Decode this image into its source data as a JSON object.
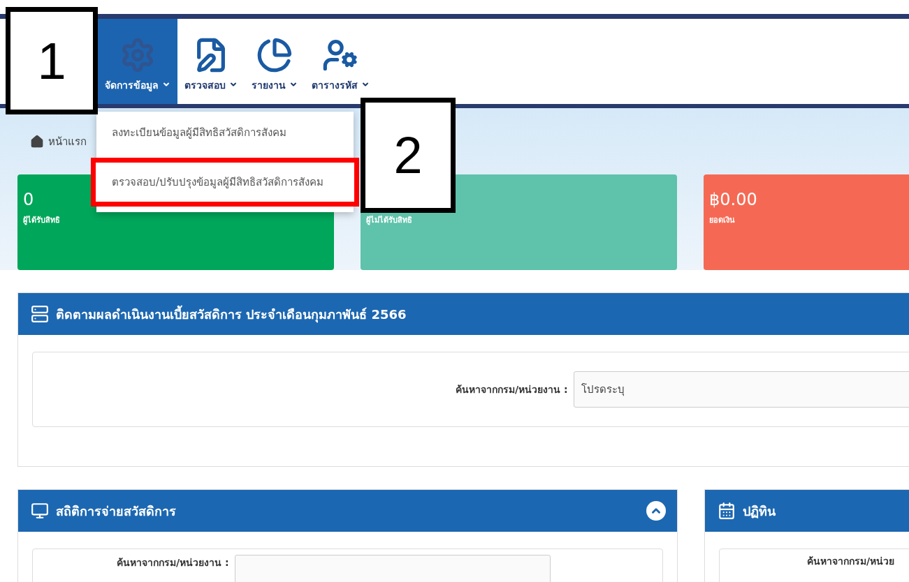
{
  "nav": {
    "items": [
      {
        "label": "จัดการข้อมูล",
        "selected": true
      },
      {
        "label": "ตรวจสอบ",
        "selected": false
      },
      {
        "label": "รายงาน",
        "selected": false
      },
      {
        "label": "ตารางรหัส",
        "selected": false
      }
    ]
  },
  "dropdown": {
    "items": [
      {
        "label": "ลงทะเบียนข้อมูลผู้มีสิทธิสวัสดิการสังคม",
        "highlighted": false
      },
      {
        "label": "ตรวจสอบ/ปรับปรุงข้อมูลผู้มีสิทธิสวัสดิการสังคม",
        "highlighted": true
      }
    ]
  },
  "breadcrumb": {
    "label": "หน้าแรก"
  },
  "stats": [
    {
      "value": "0",
      "label": "ผู้ได้รับสิทธิ",
      "color": "#00a65a"
    },
    {
      "label": "ผู้ไม่ได้รับสิทธิ",
      "color": "#5fc2ab"
    },
    {
      "value": "฿0.00",
      "label": "ยอดเงิน",
      "color": "#f56954"
    }
  ],
  "tracking_panel": {
    "title": "ติดตามผลดำเนินงานเบี้ยสวัสดิการ ประจำเดือนกุมภาพันธ์ 2566",
    "search_label": "ค้นหาจากกรม/หน่วยงาน :",
    "select_value": "โปรดระบุ"
  },
  "stats_panel": {
    "title": "สถิติการจ่ายสวัสดิการ",
    "expanded": true,
    "search_label": "ค้นหาจากกรม/หน่วยงาน :"
  },
  "calendar_panel": {
    "title": "ปฏิทิน",
    "search_label": "ค้นหาจากกรม/หน่วย"
  },
  "annotations": [
    {
      "kind": "number",
      "label": "1"
    },
    {
      "kind": "number",
      "label": "2"
    }
  ]
}
